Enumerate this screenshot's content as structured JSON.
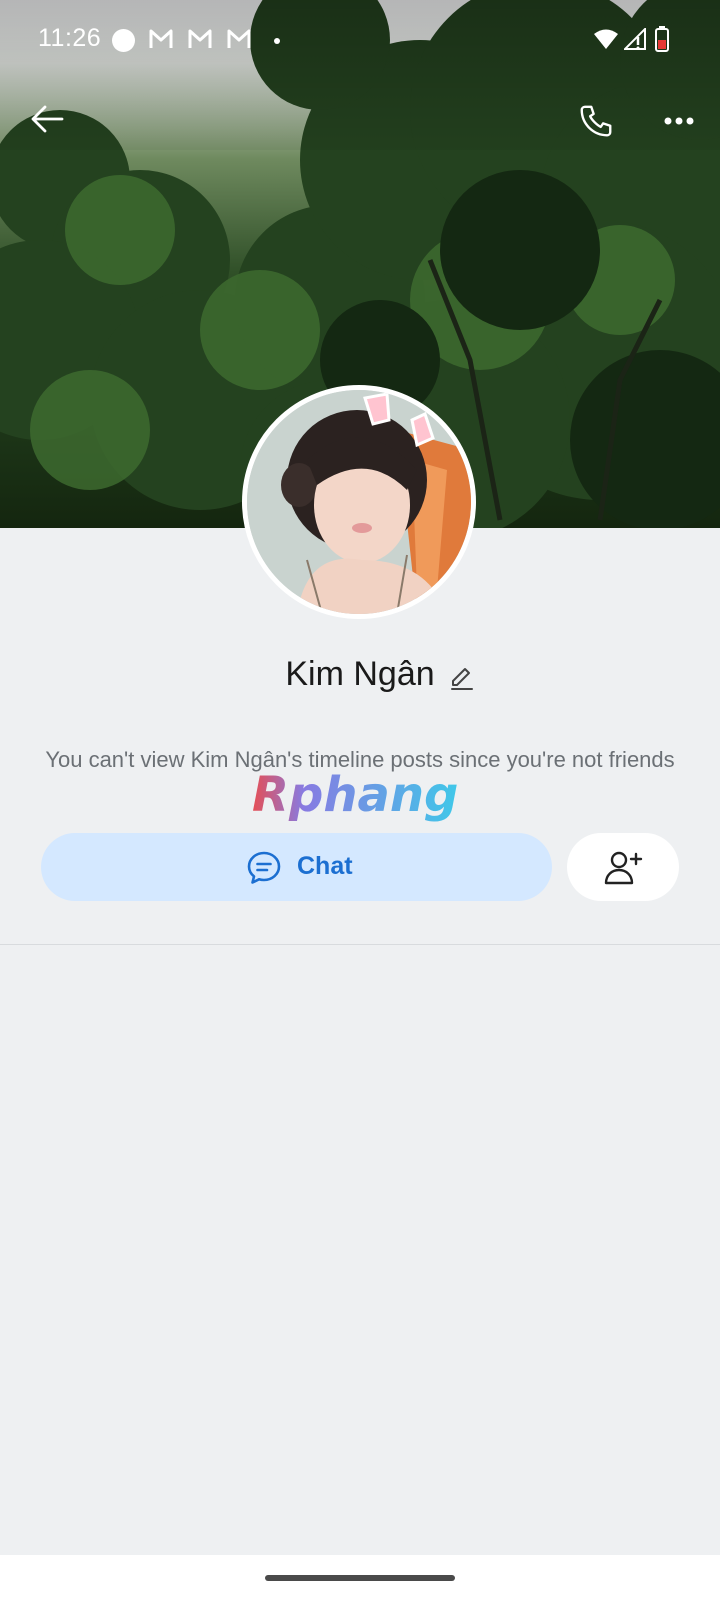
{
  "status_bar": {
    "time": "11:26",
    "icons": [
      "circle-notification-icon",
      "gmail-icon",
      "gmail-icon",
      "gmail-icon",
      "more-notifications-dot",
      "wifi-icon",
      "signal-icon",
      "battery-icon"
    ]
  },
  "header": {
    "back_icon": "arrow-left-icon",
    "call_icon": "phone-icon",
    "more_icon": "more-horizontal-icon"
  },
  "profile": {
    "name": "Kim Ngân",
    "edit_icon": "pencil-icon",
    "privacy_note": "You can't view Kim Ngân's timeline posts since you're not friends"
  },
  "actions": {
    "chat_label": "Chat",
    "chat_icon": "chat-bubble-icon",
    "add_friend_icon": "add-friend-icon"
  },
  "watermark": {
    "text": "Rphang"
  },
  "colors": {
    "accent": "#1c6fd1",
    "chat_button_bg": "#d4e8ff",
    "page_bg": "#eef0f2"
  }
}
